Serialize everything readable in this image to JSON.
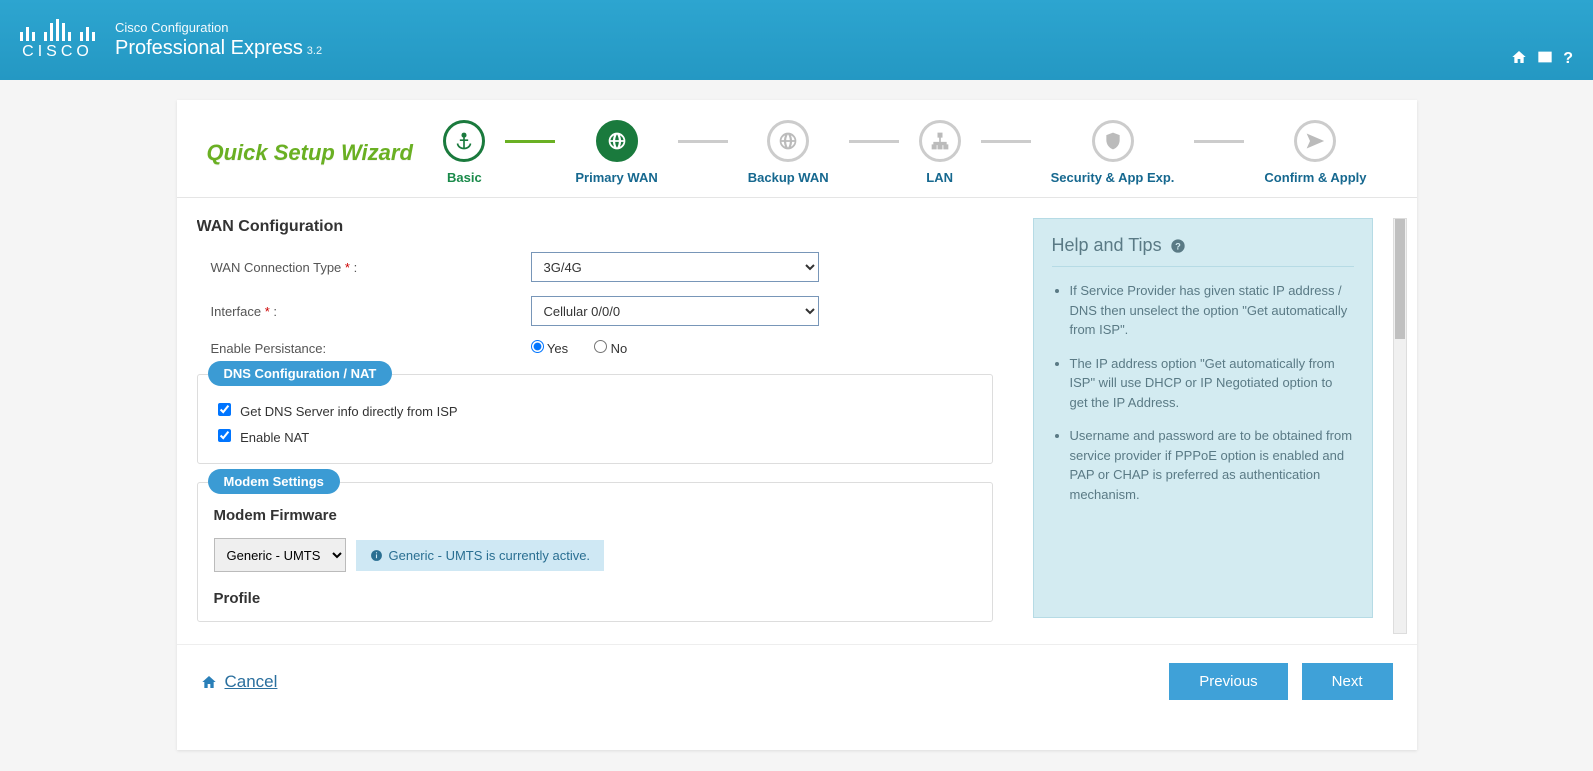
{
  "header": {
    "subtitle": "Cisco Configuration",
    "title": "Professional Express",
    "version": "3.2",
    "logo_text": "CISCO"
  },
  "wizard": {
    "title": "Quick Setup Wizard",
    "steps": [
      {
        "label": "Basic",
        "state": "done",
        "icon": "anchor"
      },
      {
        "label": "Primary WAN",
        "state": "active",
        "icon": "globe"
      },
      {
        "label": "Backup WAN",
        "state": "pending",
        "icon": "globe"
      },
      {
        "label": "LAN",
        "state": "pending",
        "icon": "sitemap"
      },
      {
        "label": "Security & App Exp.",
        "state": "pending",
        "icon": "shield"
      },
      {
        "label": "Confirm & Apply",
        "state": "pending",
        "icon": "send"
      }
    ]
  },
  "form": {
    "section_title": "WAN Configuration",
    "conn_type": {
      "label": "WAN Connection Type",
      "required": true,
      "value": "3G/4G"
    },
    "interface": {
      "label": "Interface",
      "required": true,
      "value": "Cellular 0/0/0"
    },
    "persistence": {
      "label": "Enable Persistance:",
      "yes": "Yes",
      "no": "No",
      "value": "Yes"
    },
    "dns_section": {
      "legend": "DNS Configuration / NAT",
      "get_dns": {
        "label": "Get DNS Server info directly from ISP",
        "checked": true
      },
      "enable_nat": {
        "label": "Enable NAT",
        "checked": true
      }
    },
    "modem_section": {
      "legend": "Modem Settings",
      "firmware_title": "Modem Firmware",
      "firmware_value": "Generic - UMTS",
      "info_text": "Generic - UMTS is currently active.",
      "profile_title": "Profile"
    }
  },
  "help": {
    "title": "Help and Tips",
    "tips": [
      "If Service Provider has given static IP address / DNS then unselect the option \"Get automatically from ISP\".",
      "The IP address option \"Get automatically from ISP\" will use DHCP or IP Negotiated option to get the IP Address.",
      "Username and password are to be obtained from service provider if PPPoE option is enabled and PAP or CHAP is preferred as authentication mechanism."
    ]
  },
  "footer": {
    "cancel": "Cancel",
    "previous": "Previous",
    "next": "Next"
  }
}
